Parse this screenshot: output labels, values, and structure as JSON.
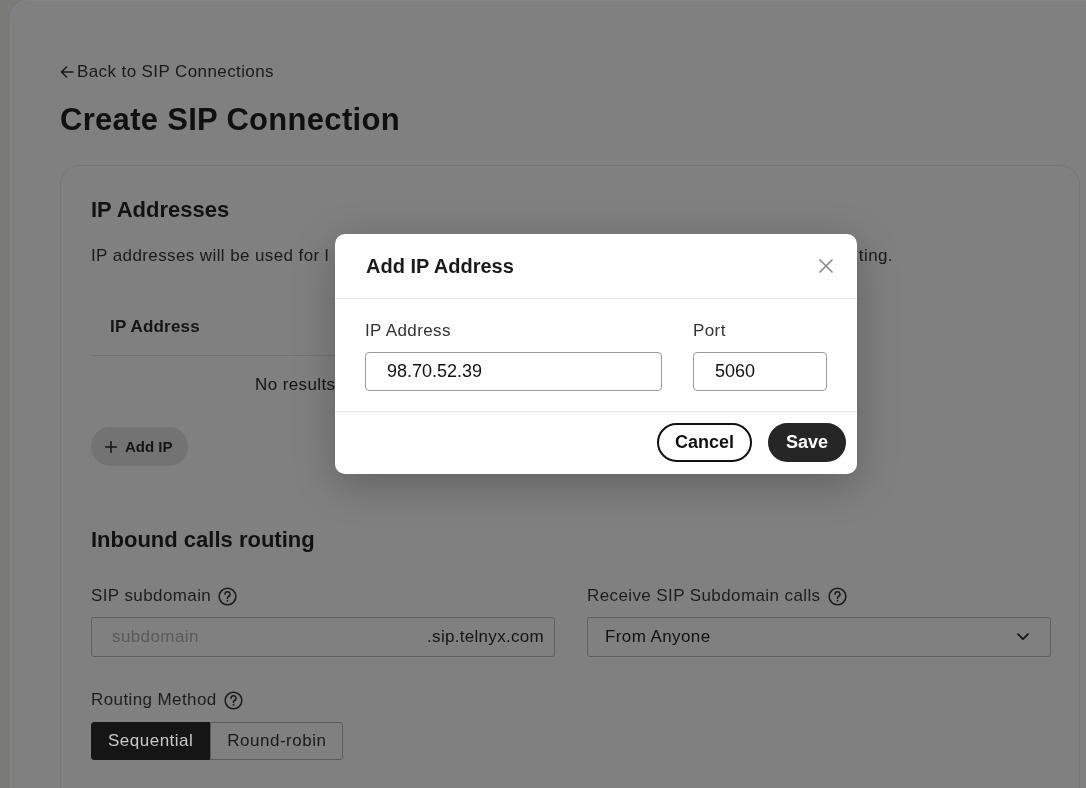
{
  "back_link": {
    "label": "Back to SIP Connections"
  },
  "page_title": "Create SIP Connection",
  "ip_addresses": {
    "heading": "IP Addresses",
    "description_fragments": [
      "IP addresses will be used for l",
      "ting."
    ],
    "table": {
      "columns": [
        "IP Address"
      ],
      "empty_text": "No results"
    },
    "add_button": {
      "label": "Add IP"
    }
  },
  "inbound_routing": {
    "heading": "Inbound calls routing",
    "fields": [
      {
        "kind": "suffix_input",
        "label": "SIP subdomain",
        "placeholder": "subdomain",
        "suffix": ".sip.telnyx.com"
      },
      {
        "kind": "select",
        "label": "Receive SIP Subdomain calls",
        "value": "From Anyone"
      }
    ],
    "routing_method": {
      "label": "Routing Method",
      "options": [
        {
          "label": "Sequential",
          "selected": true
        },
        {
          "label": "Round-robin",
          "selected": false
        }
      ]
    }
  },
  "dialog": {
    "title": "Add IP Address",
    "fields": [
      {
        "label": "IP Address",
        "value": "98.70.52.39"
      },
      {
        "label": "Port",
        "value": "5060"
      }
    ],
    "buttons": [
      {
        "kind": "secondary",
        "label": "Cancel"
      },
      {
        "kind": "primary",
        "label": "Save"
      }
    ]
  }
}
